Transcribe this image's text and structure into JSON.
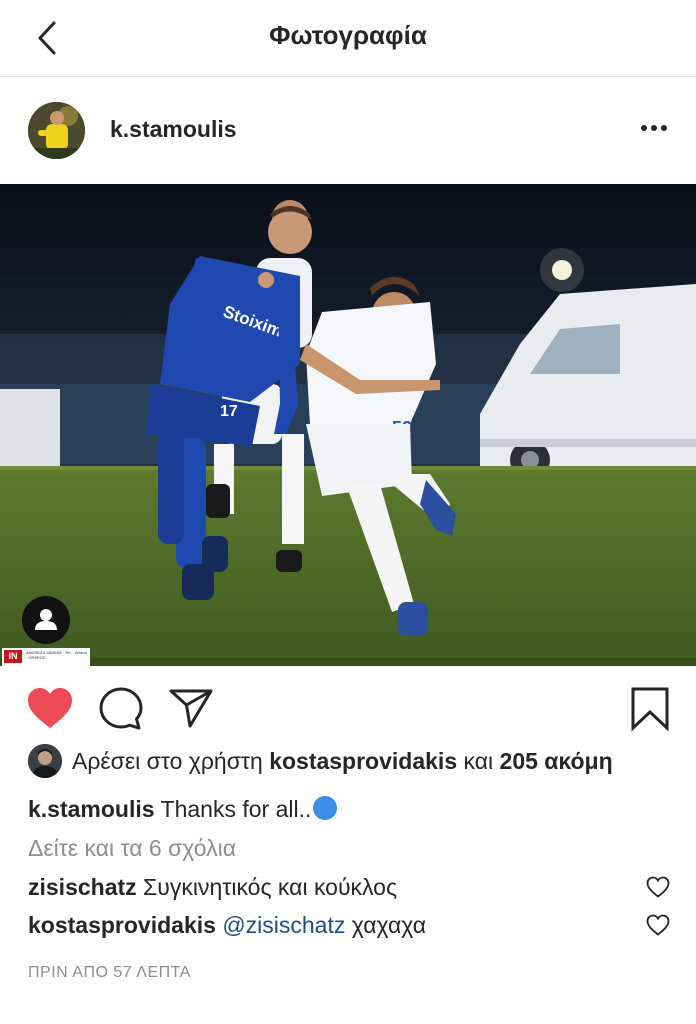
{
  "header": {
    "title": "Φωτογραφία",
    "back_icon": "chevron-left-icon"
  },
  "post": {
    "username": "k.stamoulis",
    "more_icon": "more-horizontal-icon",
    "image_alt": "photo",
    "watermark_logo": "IN",
    "watermark_text": "ANDREAS MANIAS · Tel. · Athens · GREECE"
  },
  "actions": {
    "like_icon": "heart-filled-icon",
    "comment_icon": "comment-icon",
    "share_icon": "send-icon",
    "save_icon": "bookmark-icon",
    "like_color": "#ed4956"
  },
  "likes": {
    "prefix": "Αρέσει στο χρήστη",
    "user": "kostasprovidakis",
    "middle": "και",
    "count_text": "205 ακόμη"
  },
  "caption": {
    "username": "k.stamoulis",
    "text": "Thanks for all.."
  },
  "view_all_comments": "Δείτε και τα 6 σχόλια",
  "comments": [
    {
      "username": "zisischatz",
      "mention": "",
      "text": "Συγκινητικός και κούκλος"
    },
    {
      "username": "kostasprovidakis",
      "mention": "@zisischatz",
      "text": "χαχαχα"
    }
  ],
  "timestamp": "ΠΡΙΝ ΑΠΟ 57 ΛΕΠΤΑ",
  "colors": {
    "text": "#262626",
    "muted": "#8e8e8e",
    "mention": "#1f4f82",
    "divider": "#dbdbdb"
  }
}
